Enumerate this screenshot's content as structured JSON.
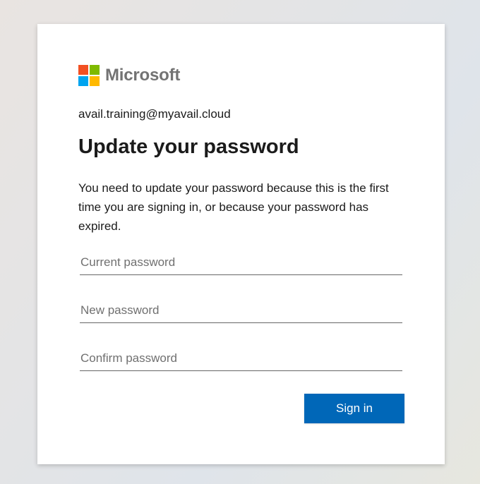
{
  "brand": {
    "name": "Microsoft",
    "colors": {
      "red": "#f25022",
      "green": "#7fba00",
      "blue": "#00a4ef",
      "yellow": "#ffb900"
    }
  },
  "account": {
    "email": "avail.training@myavail.cloud"
  },
  "page": {
    "title": "Update your password",
    "description": "You need to update your password because this is the first time you are signing in, or because your password has expired."
  },
  "form": {
    "current_password": {
      "value": "",
      "placeholder": "Current password"
    },
    "new_password": {
      "value": "",
      "placeholder": "New password"
    },
    "confirm_password": {
      "value": "",
      "placeholder": "Confirm password"
    },
    "submit_label": "Sign in",
    "accent_color": "#0067b8"
  }
}
